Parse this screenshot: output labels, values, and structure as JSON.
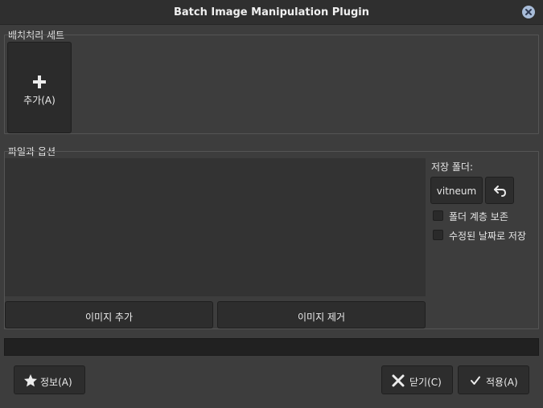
{
  "window": {
    "title": "Batch Image Manipulation Plugin"
  },
  "batch_set": {
    "frame_label": "배치처리 세트",
    "add_button_label": "추가(A)"
  },
  "files": {
    "frame_label": "파일과 옵션",
    "add_images_label": "이미지 추가",
    "remove_images_label": "이미지 제거",
    "save_folder_label": "저장 폴더:",
    "folder_name": "vitneum",
    "keep_hierarchy_label": "폴더 계층 보존",
    "keep_hierarchy_checked": false,
    "save_by_date_label": "수정된 날짜로 저장",
    "save_by_date_checked": false
  },
  "footer": {
    "about_label": "정보(A)",
    "close_label": "닫기(C)",
    "apply_label": "적용(A)"
  },
  "colors": {
    "background": "#3d3d3d",
    "button": "#2d2d2d",
    "close_icon": "#a8bcd8"
  }
}
